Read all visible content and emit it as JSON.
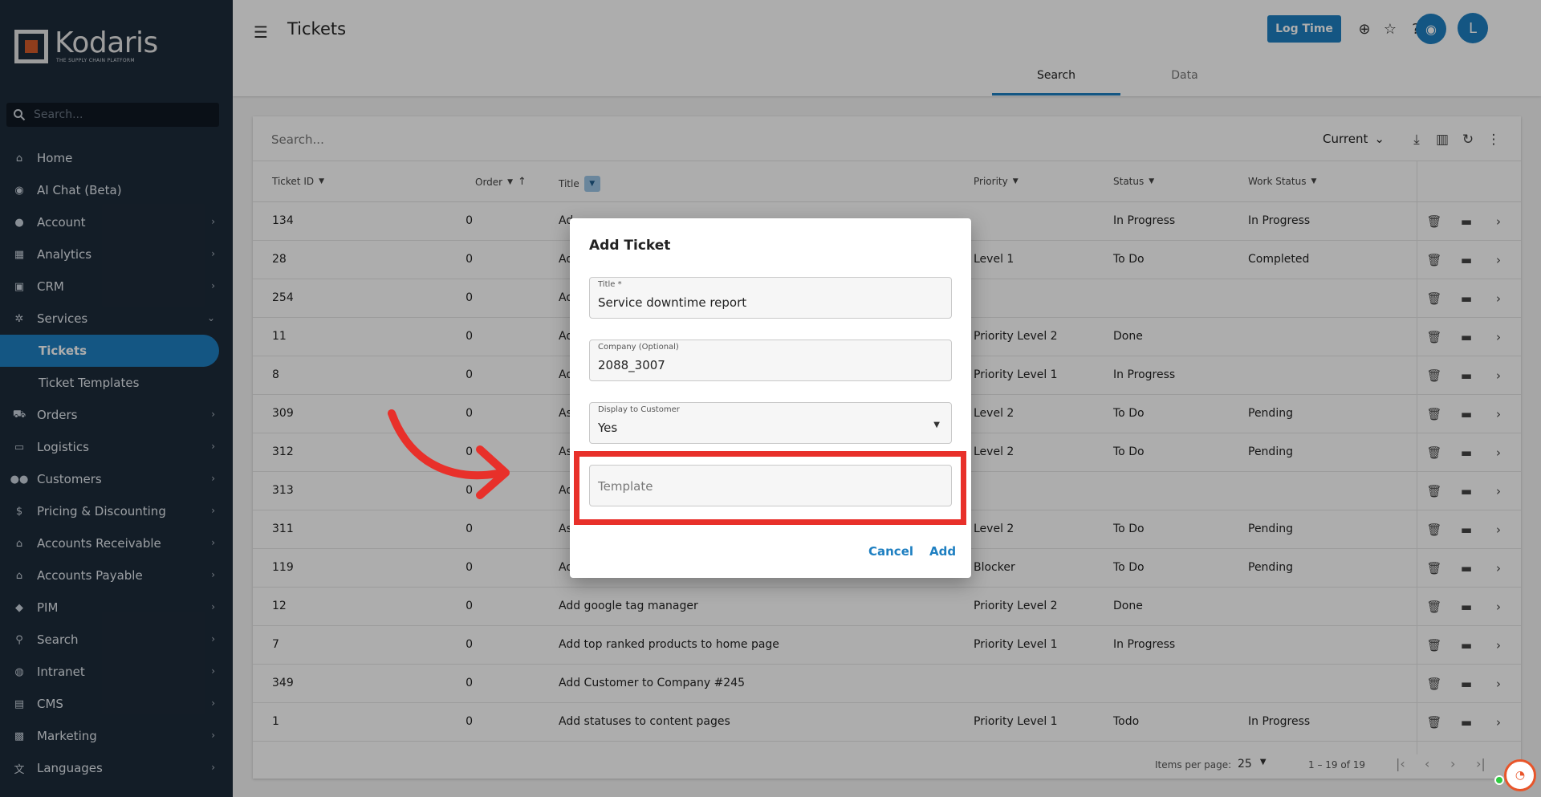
{
  "app": {
    "name": "Kodaris",
    "tagline": "THE SUPPLY CHAIN PLATFORM"
  },
  "sidebar": {
    "search_placeholder": "Search...",
    "items": [
      {
        "label": "Home",
        "icon": "home-icon"
      },
      {
        "label": "AI Chat (Beta)",
        "icon": "robot-icon"
      },
      {
        "label": "Account",
        "icon": "person-icon"
      },
      {
        "label": "Analytics",
        "icon": "chart-icon"
      },
      {
        "label": "CRM",
        "icon": "contact-icon"
      },
      {
        "label": "Services",
        "icon": "gears-icon"
      },
      {
        "label": "Tickets",
        "icon": ""
      },
      {
        "label": "Ticket Templates",
        "icon": ""
      },
      {
        "label": "Orders",
        "icon": "truck-icon"
      },
      {
        "label": "Logistics",
        "icon": "shipping-icon"
      },
      {
        "label": "Customers",
        "icon": "people-icon"
      },
      {
        "label": "Pricing & Discounting",
        "icon": "dollar-icon"
      },
      {
        "label": "Accounts Receivable",
        "icon": "bank-icon"
      },
      {
        "label": "Accounts Payable",
        "icon": "bank-icon"
      },
      {
        "label": "PIM",
        "icon": "tag-icon"
      },
      {
        "label": "Search",
        "icon": "search-icon"
      },
      {
        "label": "Intranet",
        "icon": "globe-icon"
      },
      {
        "label": "CMS",
        "icon": "web-icon"
      },
      {
        "label": "Marketing",
        "icon": "marketing-icon"
      },
      {
        "label": "Languages",
        "icon": "translate-icon"
      }
    ]
  },
  "header": {
    "title": "Tickets",
    "log_time_label": "Log Time",
    "avatar_initial": "L",
    "tabs": [
      {
        "label": "Search"
      },
      {
        "label": "Data"
      }
    ]
  },
  "table": {
    "search_placeholder": "Search...",
    "filter_value": "Current",
    "columns": [
      "Ticket ID",
      "Order",
      "Title",
      "Priority",
      "Status",
      "Work Status"
    ],
    "rows": [
      {
        "id": "134",
        "order": "0",
        "title": "Ad",
        "priority": "",
        "status": "In Progress",
        "work_status": "In Progress"
      },
      {
        "id": "28",
        "order": "0",
        "title": "Ad",
        "priority": "Level 1",
        "status": "To Do",
        "work_status": "Completed"
      },
      {
        "id": "254",
        "order": "0",
        "title": "Ad",
        "priority": "",
        "status": "",
        "work_status": ""
      },
      {
        "id": "11",
        "order": "0",
        "title": "Ad",
        "priority": "Priority Level 2",
        "status": "Done",
        "work_status": ""
      },
      {
        "id": "8",
        "order": "0",
        "title": "Ad",
        "priority": "Priority Level 1",
        "status": "In Progress",
        "work_status": ""
      },
      {
        "id": "309",
        "order": "0",
        "title": "As",
        "priority": "Level 2",
        "status": "To Do",
        "work_status": "Pending"
      },
      {
        "id": "312",
        "order": "0",
        "title": "As",
        "priority": "Level 2",
        "status": "To Do",
        "work_status": "Pending"
      },
      {
        "id": "313",
        "order": "0",
        "title": "Ad",
        "priority": "",
        "status": "",
        "work_status": ""
      },
      {
        "id": "311",
        "order": "0",
        "title": "As",
        "priority": "Level 2",
        "status": "To Do",
        "work_status": "Pending"
      },
      {
        "id": "119",
        "order": "0",
        "title": "Ad",
        "priority": "Blocker",
        "status": "To Do",
        "work_status": "Pending"
      },
      {
        "id": "12",
        "order": "0",
        "title": "Add google tag manager",
        "priority": "Priority Level 2",
        "status": "Done",
        "work_status": ""
      },
      {
        "id": "7",
        "order": "0",
        "title": "Add top ranked products to home page",
        "priority": "Priority Level 1",
        "status": "In Progress",
        "work_status": ""
      },
      {
        "id": "349",
        "order": "0",
        "title": "Add Customer to Company #245",
        "priority": "",
        "status": "",
        "work_status": ""
      },
      {
        "id": "1",
        "order": "0",
        "title": "Add statuses to content pages",
        "priority": "Priority Level 1",
        "status": "Todo",
        "work_status": "In Progress"
      }
    ],
    "paginator": {
      "label": "Items per page:",
      "page_size": "25",
      "range": "1 – 19 of 19"
    }
  },
  "dialog": {
    "title": "Add Ticket",
    "fields": {
      "title": {
        "label": "Title *",
        "value": "Service downtime report"
      },
      "company": {
        "label": "Company (Optional)",
        "value": "2088_3007"
      },
      "display": {
        "label": "Display to Customer",
        "value": "Yes"
      },
      "template": {
        "placeholder": "Template"
      }
    },
    "cancel_label": "Cancel",
    "add_label": "Add"
  },
  "colors": {
    "accent": "#1e7fc1",
    "sidebar": "#1d2b3a",
    "highlight": "#e8302a",
    "brand": "#d35a2a"
  }
}
